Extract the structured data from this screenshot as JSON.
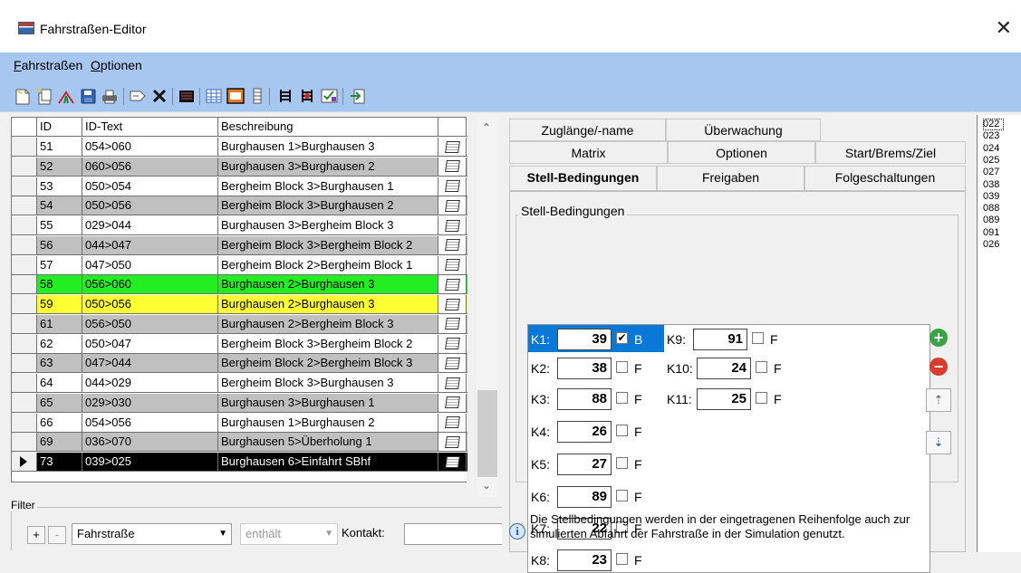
{
  "window": {
    "title": "Fahrstraßen-Editor",
    "close_glyph": "✕"
  },
  "menu": [
    "Fahrstraßen",
    "Optionen"
  ],
  "toolbar": {
    "icons": [
      "new-file-icon",
      "copy-icon",
      "route-icon",
      "save-icon",
      "print-icon",
      "edit-tag-icon",
      "delete-icon",
      "list-view-icon",
      "table-icon",
      "detail-icon",
      "single-column-icon",
      "signal-icon",
      "signal-red-icon",
      "checklist-icon",
      "exit-icon"
    ]
  },
  "grid": {
    "headers": [
      "ID",
      "ID-Text",
      "Beschreibung"
    ],
    "rows": [
      {
        "id": "51",
        "text": "054>060",
        "desc": "Burghausen 1>Burghausen 3",
        "bg": "#ffffff",
        "fg": "#000000"
      },
      {
        "id": "52",
        "text": "060>056",
        "desc": "Burghausen 3>Burghausen 2",
        "bg": "#c0c0c0",
        "fg": "#000000"
      },
      {
        "id": "53",
        "text": "050>054",
        "desc": "Bergheim Block 3>Burghausen 1",
        "bg": "#ffffff",
        "fg": "#000000"
      },
      {
        "id": "54",
        "text": "050>056",
        "desc": "Bergheim Block 3>Burghausen 2",
        "bg": "#c0c0c0",
        "fg": "#000000"
      },
      {
        "id": "55",
        "text": "029>044",
        "desc": "Burghausen 3>Bergheim Block 3",
        "bg": "#ffffff",
        "fg": "#000000"
      },
      {
        "id": "56",
        "text": "044>047",
        "desc": "Bergheim Block 3>Bergheim Block 2",
        "bg": "#c0c0c0",
        "fg": "#000000"
      },
      {
        "id": "57",
        "text": "047>050",
        "desc": "Bergheim Block 2>Bergheim Block 1",
        "bg": "#ffffff",
        "fg": "#000000"
      },
      {
        "id": "58",
        "text": "056>060",
        "desc": "Burghausen 2>Burghausen 3",
        "bg": "#22ee22",
        "fg": "#000000"
      },
      {
        "id": "59",
        "text": "050>056",
        "desc": "Burghausen 2>Burghausen 3",
        "bg": "#ffff33",
        "fg": "#000000"
      },
      {
        "id": "61",
        "text": "056>050",
        "desc": "Burghausen 2>Bergheim Block 3",
        "bg": "#c0c0c0",
        "fg": "#000000"
      },
      {
        "id": "62",
        "text": "050>047",
        "desc": "Bergheim Block 3>Bergheim Block 2",
        "bg": "#ffffff",
        "fg": "#000000"
      },
      {
        "id": "63",
        "text": "047>044",
        "desc": "Bergheim Block 2>Bergheim Block 3",
        "bg": "#c0c0c0",
        "fg": "#000000"
      },
      {
        "id": "64",
        "text": "044>029",
        "desc": "Bergheim Block 3>Burghausen 3",
        "bg": "#ffffff",
        "fg": "#000000"
      },
      {
        "id": "65",
        "text": "029>030",
        "desc": "Burghausen 3>Burghausen 1",
        "bg": "#c0c0c0",
        "fg": "#000000"
      },
      {
        "id": "66",
        "text": "054>056",
        "desc": "Burghausen 1>Burghausen 2",
        "bg": "#ffffff",
        "fg": "#000000"
      },
      {
        "id": "69",
        "text": "036>070",
        "desc": "Burghausen 5>Überholung 1",
        "bg": "#c0c0c0",
        "fg": "#000000"
      },
      {
        "id": "73",
        "text": "039>025",
        "desc": "Burghausen 6>Einfahrt SBhf",
        "bg": "#000000",
        "fg": "#ffffff",
        "current": true
      }
    ]
  },
  "filter": {
    "title": "Filter",
    "plus": "+",
    "minus": "-",
    "field_value": "Fahrstraße",
    "operator_value": "enthält",
    "contact_label": "Kontakt:"
  },
  "tabs": {
    "row1": [
      "Zuglänge/-name",
      "Überwachung"
    ],
    "row2": [
      "Matrix",
      "Optionen",
      "Start/Brems/Ziel"
    ],
    "row3": [
      "Stell-Bedingungen",
      "Freigaben",
      "Folgeschaltungen"
    ],
    "active": "Stell-Bedingungen"
  },
  "conditions_group": {
    "title": "Stell-Bedingungen",
    "items": [
      {
        "label": "K1:",
        "value": "39",
        "checked": true,
        "flag": "B",
        "selected": true
      },
      {
        "label": "K2:",
        "value": "38",
        "checked": false,
        "flag": "F"
      },
      {
        "label": "K3:",
        "value": "88",
        "checked": false,
        "flag": "F"
      },
      {
        "label": "K4:",
        "value": "26",
        "checked": false,
        "flag": "F"
      },
      {
        "label": "K5:",
        "value": "27",
        "checked": false,
        "flag": "F"
      },
      {
        "label": "K6:",
        "value": "89",
        "checked": false,
        "flag": "F"
      },
      {
        "label": "K7:",
        "value": "22",
        "checked": false,
        "flag": "F"
      },
      {
        "label": "K8:",
        "value": "23",
        "checked": false,
        "flag": "F"
      },
      {
        "label": "K9:",
        "value": "91",
        "checked": false,
        "flag": "F"
      },
      {
        "label": "K10:",
        "value": "24",
        "checked": false,
        "flag": "F"
      },
      {
        "label": "K11:",
        "value": "25",
        "checked": false,
        "flag": "F"
      }
    ]
  },
  "info": {
    "text": "Die Stellbedingungen werden in der eingetragenen Reihenfolge auch zur simulierten Abfahrt der Fahrstraße in der Simulation genutzt."
  },
  "contacts": [
    "022",
    "023",
    "024",
    "025",
    "027",
    "038",
    "039",
    "088",
    "089",
    "091",
    "026"
  ],
  "colors": {
    "menubar": "#a7c7f0",
    "selection_blue": "#0a78d7",
    "row_green": "#22ee22",
    "row_yellow": "#ffff33",
    "row_current": "#000000"
  }
}
